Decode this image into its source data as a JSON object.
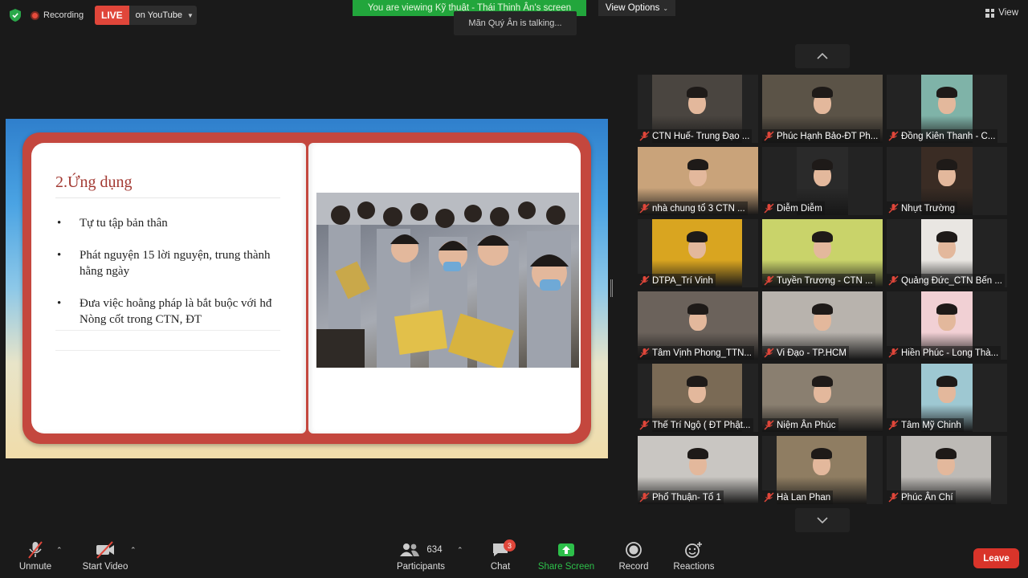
{
  "topbar": {
    "recording_label": "Recording",
    "live_badge": "LIVE",
    "live_destination": "on YouTube",
    "viewing_banner": "You are viewing Kỹ thuật - Thái Thịnh Ân's screen",
    "talking_indicator": "Mãn Quý Ân is talking...",
    "view_options_label": "View Options",
    "view_label": "View"
  },
  "slide": {
    "title": "2.Ứng dụng",
    "bullets": [
      "Tự tu tập bản thân",
      "Phát nguyện 15 lời nguyện, trung thành hằng ngày",
      "Đưa việc hoằng pháp là bắt buộc với hđ Nòng cốt trong CTN, ĐT"
    ],
    "photo_description": "photo-of-monks-praying"
  },
  "participants": [
    {
      "name": "CTN Huế- Trung Đạo ...",
      "bg": "#4a4540"
    },
    {
      "name": "Phúc Hạnh Bảo-ĐT Ph...",
      "bg": "#5b5347"
    },
    {
      "name": "Đồng Kiên Thanh - C...",
      "bg": "#7fb3a8"
    },
    {
      "name": "nhà chung tổ 3 CTN ...",
      "bg": "#c9a37a"
    },
    {
      "name": "Diễm Diễm",
      "bg": "#2a2a2a"
    },
    {
      "name": "Nhựt Trường",
      "bg": "#3a2c24"
    },
    {
      "name": "DTPA_Trí Vinh",
      "bg": "#d9a520"
    },
    {
      "name": "Tuyền Trương - CTN ...",
      "bg": "#c9d36a"
    },
    {
      "name": "Quảng Đức_CTN Bến ...",
      "bg": "#e9e6e2"
    },
    {
      "name": "Tâm Vịnh Phong_TTN...",
      "bg": "#6b625b"
    },
    {
      "name": "Vi Đạo - TP.HCM",
      "bg": "#b8b3ad"
    },
    {
      "name": "Hiền Phúc - Long Thà...",
      "bg": "#f1d0d4"
    },
    {
      "name": "Thế Trí Ngộ ( ĐT Phật...",
      "bg": "#7a6a55"
    },
    {
      "name": "Niệm Ân Phúc",
      "bg": "#8a7f70"
    },
    {
      "name": "Tâm Mỹ Chinh",
      "bg": "#9ec8d2"
    },
    {
      "name": "Phổ Thuận- Tổ 1",
      "bg": "#c9c6c2"
    },
    {
      "name": "Hà Lan Phan",
      "bg": "#8f7d62"
    },
    {
      "name": "Phúc Ân Chí",
      "bg": "#bdbab6"
    }
  ],
  "toolbar": {
    "unmute_label": "Unmute",
    "start_video_label": "Start Video",
    "participants_label": "Participants",
    "participants_count": "634",
    "chat_label": "Chat",
    "chat_badge": "3",
    "share_label": "Share Screen",
    "record_label": "Record",
    "reactions_label": "Reactions",
    "leave_label": "Leave"
  },
  "colors": {
    "live_red": "#e0463a",
    "banner_green": "#22a63c",
    "share_green": "#2dbf4a",
    "leave_red": "#d9342a",
    "book_red": "#c4473e",
    "title_red": "#a33a33"
  }
}
